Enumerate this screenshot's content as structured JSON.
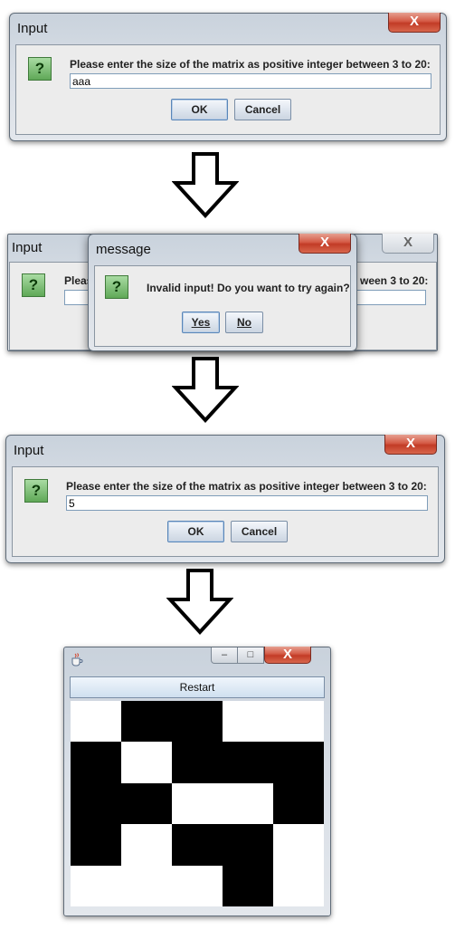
{
  "dialog1": {
    "title": "Input",
    "close_label": "X",
    "prompt": "Please enter the size of the matrix as positive integer between 3 to 20:",
    "value": "aaa",
    "ok_label": "OK",
    "cancel_label": "Cancel"
  },
  "dialog2": {
    "background_title": "Input",
    "background_prompt_start": "Pleas",
    "background_prompt_end": "ween 3 to 20:",
    "title": "message",
    "close_label": "X",
    "prompt": "Invalid input! Do you want to try again?",
    "yes_label": "Yes",
    "no_label": "No"
  },
  "dialog3": {
    "title": "Input",
    "close_label": "X",
    "prompt": "Please enter the size of the matrix as positive integer between 3 to 20:",
    "value": "5",
    "ok_label": "OK",
    "cancel_label": "Cancel"
  },
  "matrix_window": {
    "icon": "java-cup-icon",
    "restart_label": "Restart",
    "close_label": "X",
    "grid_size": 5,
    "cells": [
      [
        "w",
        "b",
        "b",
        "w",
        "w"
      ],
      [
        "b",
        "w",
        "b",
        "b",
        "b"
      ],
      [
        "b",
        "b",
        "w",
        "w",
        "b"
      ],
      [
        "b",
        "w",
        "b",
        "b",
        "w"
      ],
      [
        "w",
        "w",
        "w",
        "b",
        "w"
      ]
    ]
  },
  "flow_arrows": [
    "down-arrow",
    "down-arrow",
    "down-arrow"
  ],
  "colors": {
    "close_red": "#c23b26",
    "help_green": "#5fa857",
    "dark_cell": "#000000",
    "light_cell": "#ffffff"
  }
}
